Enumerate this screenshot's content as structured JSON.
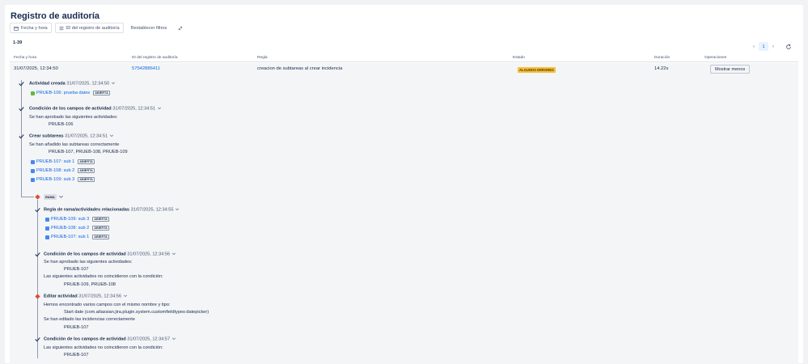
{
  "page_title": "Registro de auditoría",
  "toolbar": {
    "date_filter": "Fecha y hora",
    "id_filter": "ID del registro de auditoría",
    "reset_filters": "Restablecer filtros"
  },
  "result_count": "1-39",
  "pagination": {
    "current": "1"
  },
  "table": {
    "headers": [
      "Fecha y hora",
      "ID del registro de auditoría",
      "Regla",
      "Estado",
      "Duración",
      "Operaciones"
    ],
    "row": {
      "datetime": "31/07/2025, 12:34:50",
      "audit_id": "57542886411",
      "rule": "creacion de subtareas al crear incidencia",
      "status": "ALGUNOS ERRORES",
      "duration": "14.22s",
      "action": "Mostrar menos"
    }
  },
  "detail": {
    "activity_created": {
      "title": "Actividad creada",
      "time": "31/07/2025, 12:34:50",
      "issue": "PRUEB-106: prueba dates",
      "issue_status": "ABIERTA"
    },
    "condition1": {
      "title": "Condición de los campos de actividad",
      "time": "31/07/2025, 12:34:51",
      "text": "Se han aprobado las siguientes actividades:",
      "issues": "PRUEB-106"
    },
    "create_subtasks": {
      "title": "Crear subtareas",
      "time": "31/07/2025, 12:34:51",
      "text": "Se han añadido las subtareas correctamente",
      "issues": "PRUEB-107, PRUEB-108, PRUEB-109",
      "links": [
        {
          "label": "PRUEB-107: sub 1",
          "status": "ABIERTA"
        },
        {
          "label": "PRUEB-108: sub 2",
          "status": "ABIERTA"
        },
        {
          "label": "PRUEB-109: sub 3",
          "status": "ABIERTA"
        }
      ]
    },
    "branch": {
      "label": "RAMA"
    },
    "branch_rule": {
      "title": "Regla de rama/actividades relacionadas",
      "time": "31/07/2025, 12:34:55",
      "links": [
        {
          "label": "PRUEB-109: sub 3",
          "status": "ABIERTA"
        },
        {
          "label": "PRUEB-108: sub 2",
          "status": "ABIERTA"
        },
        {
          "label": "PRUEB-107: sub 1",
          "status": "ABIERTA"
        }
      ]
    },
    "condition2": {
      "title": "Condición de los campos de actividad",
      "time": "31/07/2025, 12:34:56",
      "text1": "Se han aprobado las siguientes actividades:",
      "issues1": "PRUEB-107",
      "text2": "Las siguientes actividades no coincidieron con la condición:",
      "issues2": "PRUEB-109, PRUEB-108"
    },
    "edit_activity": {
      "title": "Editar actividad",
      "time": "31/07/2025, 12:34:56",
      "text1": "Hemos encontrado varios campos con el mismo nombre y tipo:",
      "field": "Start date (com.atlassian.jira.plugin.system.customfieldtypes:datepicker)",
      "text2": "Se han editado las incidencias correctamente",
      "issues": "PRUEB-107"
    },
    "condition3": {
      "title": "Condición de los campos de actividad",
      "time": "31/07/2025, 12:34:57",
      "text": "Las siguientes actividades no coincidieron con la condición:",
      "issues": "PRUEB-107"
    }
  },
  "colors": {
    "link": "#0c66e4",
    "error_badge": "#f8c03a",
    "error_icon": "#e2483d",
    "success_check": "#172b4d"
  },
  "icons": {
    "check": "check-icon",
    "error": "error-diamond-icon",
    "chevron": "chevron-down-icon",
    "calendar": "calendar-icon",
    "list": "list-icon",
    "link": "link-icon",
    "refresh": "refresh-icon"
  }
}
